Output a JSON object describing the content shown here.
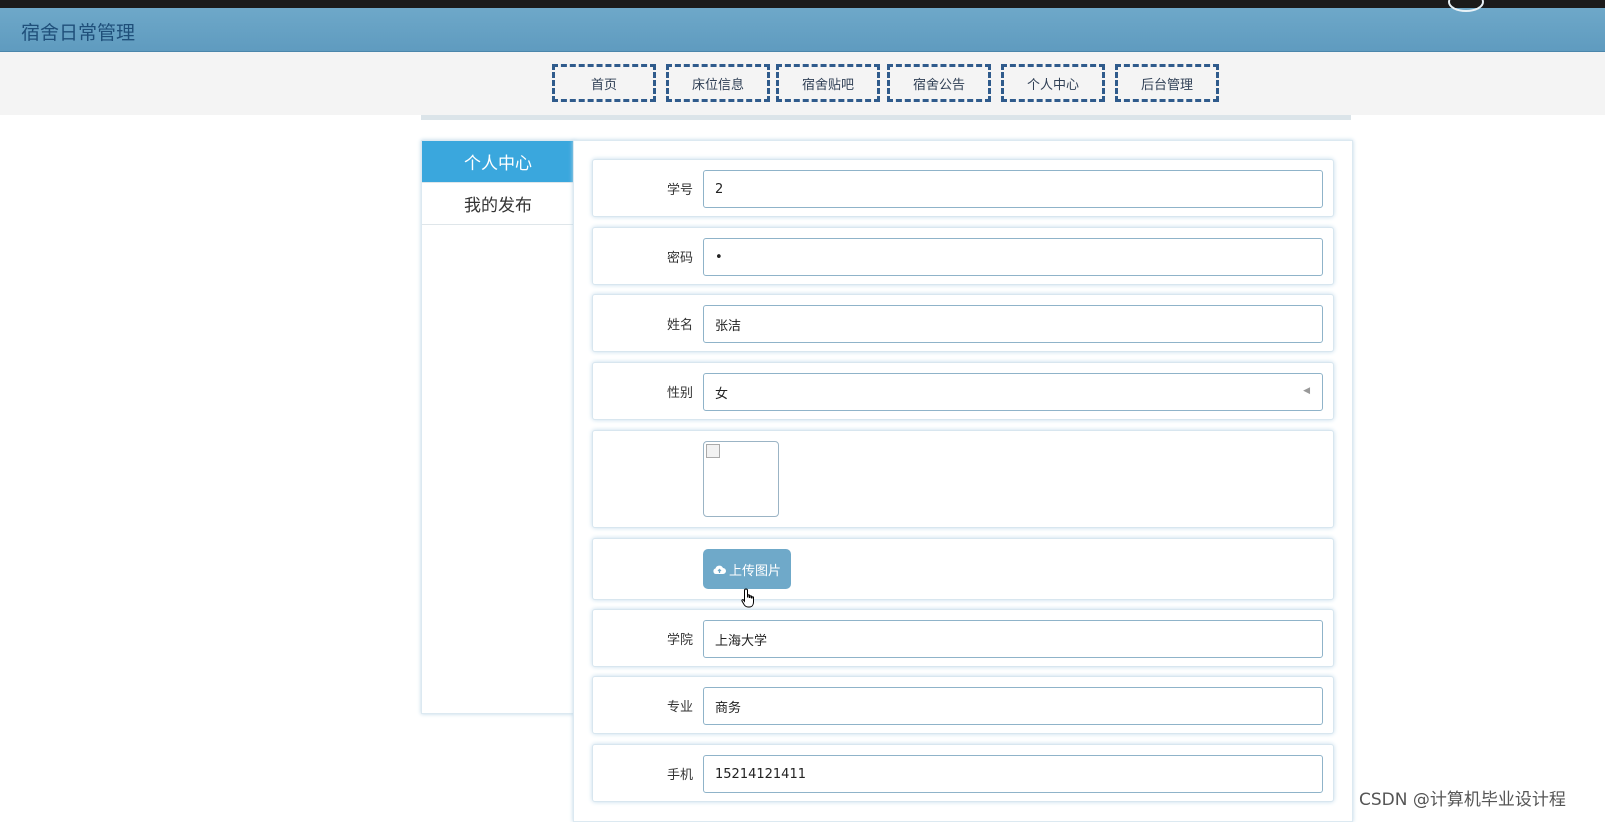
{
  "app": {
    "title": "宿舍日常管理"
  },
  "nav": {
    "items": [
      {
        "label": "首页"
      },
      {
        "label": "床位信息"
      },
      {
        "label": "宿舍贴吧"
      },
      {
        "label": "宿舍公告"
      },
      {
        "label": "个人中心"
      },
      {
        "label": "后台管理"
      }
    ]
  },
  "sidebar": {
    "items": [
      {
        "label": "个人中心",
        "active": true
      },
      {
        "label": "我的发布",
        "active": false
      }
    ]
  },
  "form": {
    "student_id": {
      "label": "学号",
      "value": "2"
    },
    "password": {
      "label": "密码",
      "value": "•"
    },
    "name": {
      "label": "姓名",
      "value": "张洁"
    },
    "gender": {
      "label": "性别",
      "value": "女"
    },
    "upload_label": "上传图片",
    "college": {
      "label": "学院",
      "value": "上海大学"
    },
    "major": {
      "label": "专业",
      "value": "商务"
    },
    "phone": {
      "label": "手机",
      "value": "15214121411"
    }
  },
  "watermark": "CSDN @计算机毕业设计程",
  "colors": {
    "titlebar": "#6ea8c9",
    "accent": "#3aa7dd",
    "nav_border": "#2f5b8c",
    "upload_button": "#6fa9c9"
  },
  "icons": {
    "upload": "cloud-upload-icon",
    "cursor": "hand-cursor-icon"
  }
}
